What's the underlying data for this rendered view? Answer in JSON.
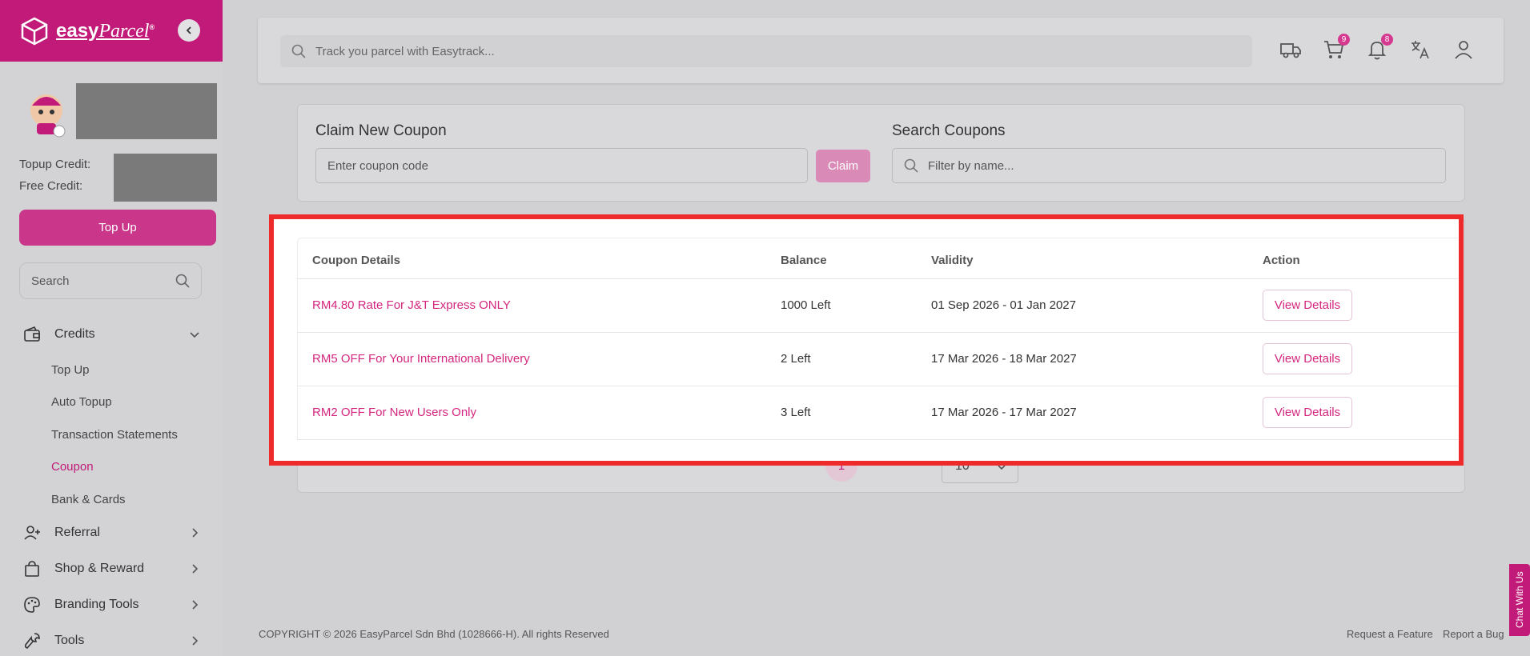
{
  "brand": {
    "name_part1": "easy",
    "name_part2": "Parcel",
    "mark": "®"
  },
  "sidebar": {
    "credit_labels": [
      "Topup Credit:",
      "Free Credit:"
    ],
    "topup_label": "Top Up",
    "search_placeholder": "Search",
    "credits": {
      "label": "Credits",
      "subitems": [
        "Top Up",
        "Auto Topup",
        "Transaction Statements",
        "Coupon",
        "Bank & Cards"
      ],
      "active": "Coupon"
    },
    "menu": [
      "Referral",
      "Shop & Reward",
      "Branding Tools",
      "Tools"
    ]
  },
  "topbar": {
    "search_placeholder": "Track you parcel with Easytrack...",
    "cart_count": "9",
    "notif_count": "8"
  },
  "claim": {
    "title": "Claim New Coupon",
    "input_placeholder": "Enter coupon code",
    "button": "Claim"
  },
  "search_coupons": {
    "title": "Search Coupons",
    "placeholder": "Filter by name..."
  },
  "table": {
    "headers": [
      "Coupon Details",
      "Balance",
      "Validity",
      "Action"
    ],
    "rows": [
      {
        "name": "RM4.80 Rate For J&T Express ONLY",
        "balance": "1000 Left",
        "validity": "01 Sep 2026 - 01 Jan 2027",
        "action": "View Details"
      },
      {
        "name": "RM5 OFF For Your International Delivery",
        "balance": "2 Left",
        "validity": "17 Mar 2026 - 18 Mar 2027",
        "action": "View Details"
      },
      {
        "name": "RM2 OFF For New Users Only",
        "balance": "3 Left",
        "validity": "17 Mar 2026 - 17 Mar 2027",
        "action": "View Details"
      }
    ]
  },
  "pagination": {
    "current": "1",
    "page_size": "10",
    "first": "«",
    "prev": "‹",
    "next": "›",
    "last": "»"
  },
  "footer": {
    "copyright": "COPYRIGHT © 2026 EasyParcel Sdn Bhd (1028666-H). All rights Reserved",
    "links": [
      "Request a Feature",
      "Report a Bug"
    ]
  },
  "chat": "Chat With Us",
  "colors": {
    "brand": "#c11a78",
    "highlight": "#ee2a2a",
    "link": "#d4267e"
  }
}
